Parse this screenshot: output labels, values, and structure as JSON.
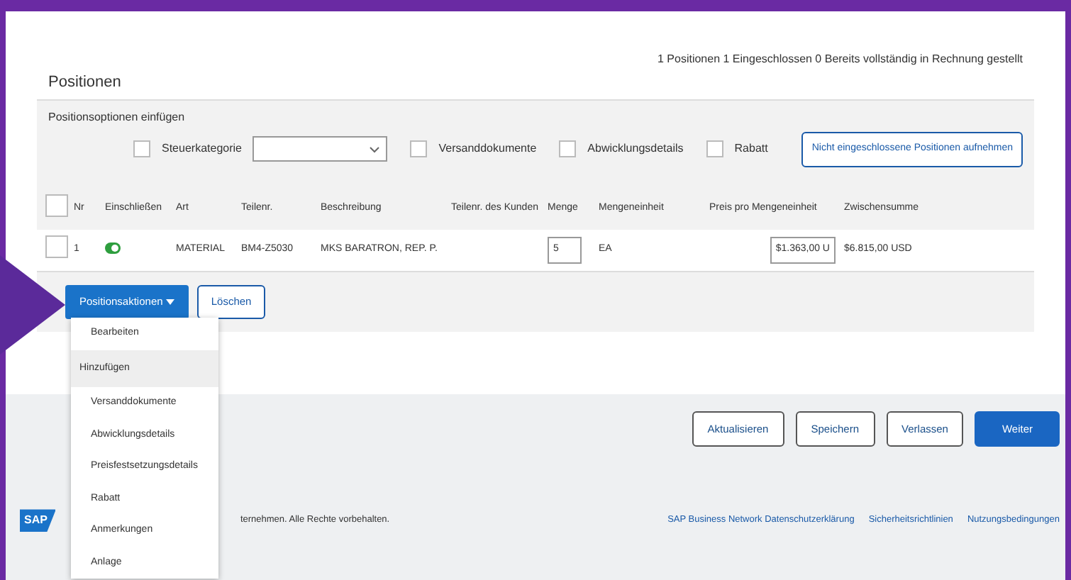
{
  "summary": "1 Positionen  1 Eingeschlossen  0 Bereits vollständig in Rechnung gestellt",
  "section_title": "Positionen",
  "options": {
    "title": "Positionsoptionen einfügen",
    "items": [
      {
        "kind": "select",
        "label": "Steuerkategorie",
        "checked": false
      },
      {
        "kind": "check",
        "label": "Versanddokumente",
        "checked": false
      },
      {
        "kind": "check",
        "label": "Abwicklungsdetails",
        "checked": false
      },
      {
        "kind": "check",
        "label": "Rabatt",
        "checked": false
      }
    ],
    "button": "Nicht eingeschlossene Positionen aufnehmen"
  },
  "table": {
    "all_checked": false,
    "columns": [
      "Nr",
      "Einschließen",
      "Art",
      "Teilenr.",
      "Beschreibung",
      "Teilenr. des Kunden",
      "Menge",
      "Mengeneinheit",
      "Preis pro Mengeneinheit",
      "Zwischensumme"
    ],
    "rows": [
      {
        "checked": false,
        "nr": "1",
        "included": true,
        "type": "MATERIAL",
        "part": "BM4-Z5030",
        "description": "MKS BARATRON, REP. P.",
        "customer_part": "",
        "quantity": "5",
        "unit": "EA",
        "price": "$1.363,00 U",
        "subtotal": "$6.815,00 USD"
      }
    ]
  },
  "actions": {
    "menu_button": "Positionsaktionen",
    "delete": "Löschen"
  },
  "menu": [
    {
      "kind": "item",
      "label": "Bearbeiten"
    },
    {
      "kind": "header",
      "label": "Hinzufügen"
    },
    {
      "kind": "item",
      "label": "Versanddokumente"
    },
    {
      "kind": "item",
      "label": "Abwicklungsdetails"
    },
    {
      "kind": "item",
      "label": "Preisfestsetzungsdetails"
    },
    {
      "kind": "item",
      "label": "Rabatt"
    },
    {
      "kind": "item",
      "label": "Anmerkungen"
    },
    {
      "kind": "item",
      "label": "Anlage"
    }
  ],
  "footer_buttons": [
    {
      "label": "Aktualisieren",
      "primary": false
    },
    {
      "label": "Speichern",
      "primary": false
    },
    {
      "label": "Verlassen",
      "primary": false
    },
    {
      "label": "Weiter",
      "primary": true
    }
  ],
  "footer": {
    "logo": "SAP",
    "copyright": "ternehmen. Alle Rechte vorbehalten.",
    "links": [
      "SAP Business Network Datenschutzerklärung",
      "Sicherheitsrichtlinien",
      "Nutzungsbedingungen"
    ]
  }
}
